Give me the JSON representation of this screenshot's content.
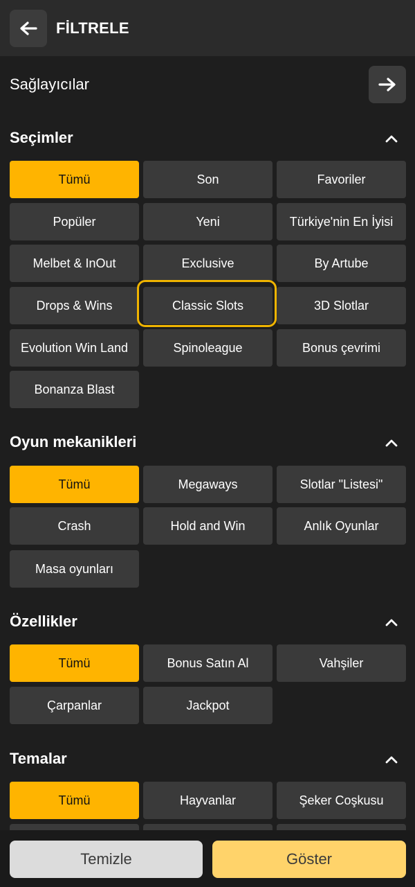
{
  "header": {
    "title": "FİLTRELE",
    "back_icon": "arrow-left-icon"
  },
  "providers": {
    "label": "Sağlayıcılar",
    "arrow_icon": "arrow-right-icon"
  },
  "sections": {
    "selections": {
      "title": "Seçimler",
      "items": [
        "Tümü",
        "Son",
        "Favoriler",
        "Popüler",
        "Yeni",
        "Türkiye'nin En İyisi",
        "Melbet & InOut",
        "Exclusive",
        "By Artube",
        "Drops & Wins",
        "Classic Slots",
        "3D Slotlar",
        "Evolution Win Land",
        "Spinoleague",
        "Bonus çevrimi",
        "Bonanza Blast"
      ]
    },
    "mechanics": {
      "title": "Oyun mekanikleri",
      "items": [
        "Tümü",
        "Megaways",
        "Slotlar \"Listesi\"",
        "Crash",
        "Hold and Win",
        "Anlık Oyunlar",
        "Masa oyunları"
      ]
    },
    "features": {
      "title": "Özellikler",
      "items": [
        "Tümü",
        "Bonus Satın Al",
        "Vahşiler",
        "Çarpanlar",
        "Jackpot"
      ]
    },
    "themes": {
      "title": "Temalar",
      "items": [
        "Tümü",
        "Hayvanlar",
        "Şeker Coşkusu"
      ]
    }
  },
  "footer": {
    "clear_label": "Temizle",
    "show_label": "Göster"
  },
  "colors": {
    "accent": "#ffb400",
    "show_button": "#ffd36a",
    "background": "#1e1e1e",
    "chip": "#3a3a3a"
  }
}
